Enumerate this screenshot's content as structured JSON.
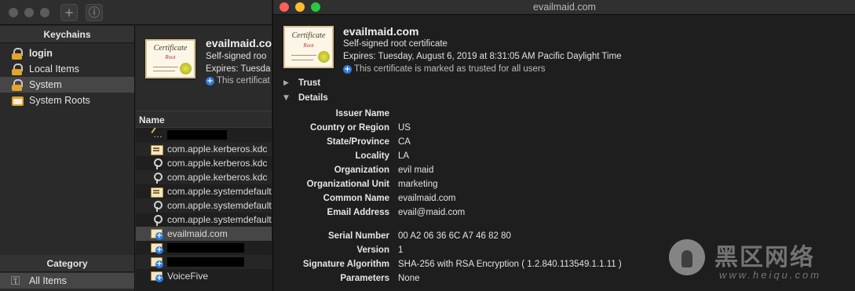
{
  "detail_window": {
    "title": "evailmaid.com",
    "cert_name": "evailmaid.com",
    "cert_kind": "Self-signed root certificate",
    "expires": "Expires: Tuesday, August 6, 2019 at 8:31:05 AM Pacific Daylight Time",
    "trust_note": "This certificate is marked as trusted for all users",
    "trust_section": "Trust",
    "details_section": "Details",
    "issuer_name_heading": "Issuer Name",
    "fields": [
      {
        "label": "Country or Region",
        "value": "US"
      },
      {
        "label": "State/Province",
        "value": "CA"
      },
      {
        "label": "Locality",
        "value": "LA"
      },
      {
        "label": "Organization",
        "value": "evil maid"
      },
      {
        "label": "Organizational Unit",
        "value": "marketing"
      },
      {
        "label": "Common Name",
        "value": "evailmaid.com"
      },
      {
        "label": "Email Address",
        "value": "evail@maid.com"
      },
      {
        "label": "Serial Number",
        "value": "00 A2 06 36 6C A7 46 82 80"
      },
      {
        "label": "Version",
        "value": "1"
      },
      {
        "label": "Signature Algorithm",
        "value": "SHA-256 with RSA Encryption ( 1.2.840.113549.1.1.11 )"
      },
      {
        "label": "Parameters",
        "value": "None"
      }
    ],
    "traffic_colors": {
      "close": "#fe5f57",
      "minimize": "#febc2e",
      "zoom": "#28c840"
    }
  },
  "keychain_window": {
    "toolbar": {
      "add_label": "+",
      "info_label": "ⓘ"
    },
    "keychains_header": "Keychains",
    "keychains": [
      {
        "label": "login",
        "icon": "lock-icon",
        "bold": true
      },
      {
        "label": "Local Items",
        "icon": "lock-icon"
      },
      {
        "label": "System",
        "icon": "lock-icon",
        "selected": true
      },
      {
        "label": "System Roots",
        "icon": "folder-icon"
      }
    ],
    "category_header": "Category",
    "category_item": "All Items",
    "preview": {
      "name": "evailmaid.com",
      "kind": "Self-signed roo",
      "expires": "Expires: Tuesda",
      "trust": "This certificat"
    },
    "list_header": "Name",
    "items": [
      {
        "label": "",
        "icon": "note-icon",
        "redacted": true
      },
      {
        "label": "com.apple.kerberos.kdc",
        "icon": "certificate-icon"
      },
      {
        "label": "com.apple.kerberos.kdc",
        "icon": "key-icon"
      },
      {
        "label": "com.apple.kerberos.kdc",
        "icon": "key-icon"
      },
      {
        "label": "com.apple.systemdefault",
        "icon": "certificate-icon"
      },
      {
        "label": "com.apple.systemdefault",
        "icon": "key-icon"
      },
      {
        "label": "com.apple.systemdefault",
        "icon": "key-icon"
      },
      {
        "label": "evailmaid.com",
        "icon": "certificate-plus-icon",
        "selected": true
      },
      {
        "label": "",
        "icon": "certificate-plus-icon",
        "redacted": true
      },
      {
        "label": "",
        "icon": "certificate-plus-icon",
        "redacted": true
      },
      {
        "label": "VoiceFive",
        "icon": "certificate-plus-icon"
      }
    ]
  },
  "certificate_image": {
    "title": "Certificate",
    "subtitle": "Root"
  },
  "watermark": {
    "text": "黑区网络",
    "url": "www.heiqu.com"
  }
}
